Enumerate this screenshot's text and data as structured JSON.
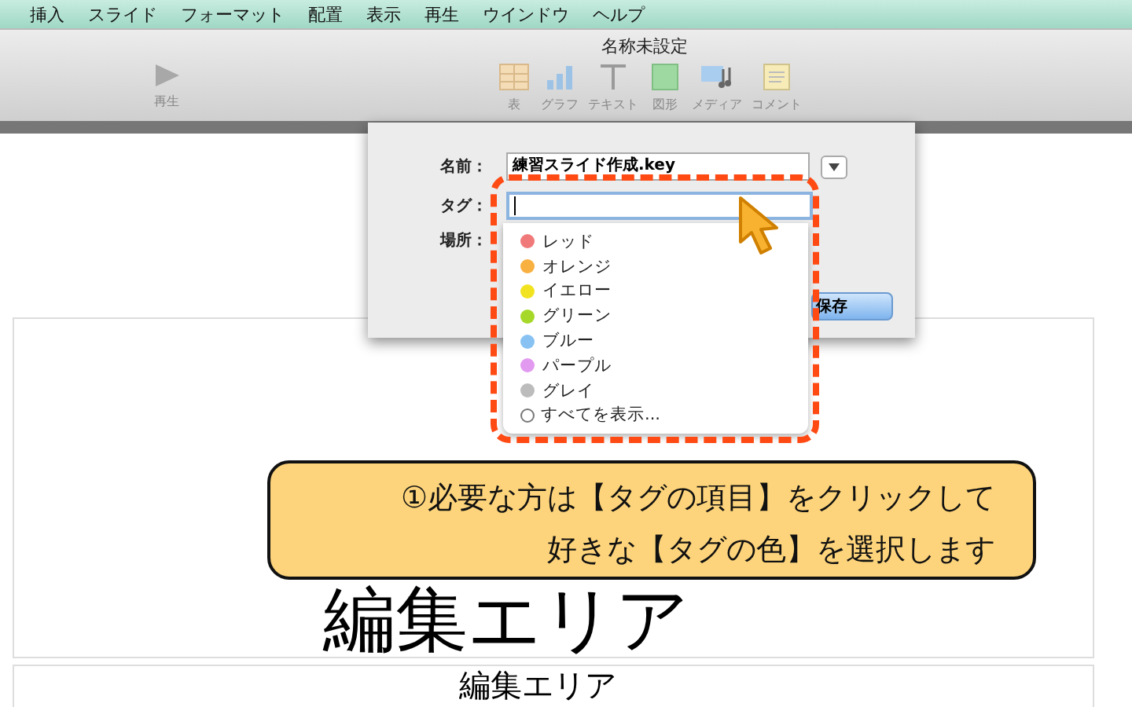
{
  "menu_bar": {
    "items": [
      "挿入",
      "スライド",
      "フォーマット",
      "配置",
      "表示",
      "再生",
      "ウインドウ",
      "ヘルプ"
    ]
  },
  "window": {
    "title": "名称未設定"
  },
  "toolbar": {
    "play": {
      "label": "再生"
    },
    "tools": [
      {
        "kind": "table",
        "label": "表"
      },
      {
        "kind": "chart",
        "label": "グラフ"
      },
      {
        "kind": "text",
        "label": "テキスト"
      },
      {
        "kind": "shape",
        "label": "図形"
      },
      {
        "kind": "media",
        "label": "メディア"
      },
      {
        "kind": "comment",
        "label": "コメント"
      }
    ]
  },
  "save_dialog": {
    "name_label": "名前：",
    "name_value": "練習スライド作成.key",
    "tag_label": "タグ：",
    "location_label": "場所：",
    "save_button": "保存",
    "tag_menu": [
      {
        "kind": "tag",
        "label": "レッド",
        "color": "#f07a7a"
      },
      {
        "kind": "tag",
        "label": "オレンジ",
        "color": "#f8b040"
      },
      {
        "kind": "tag",
        "label": "イエロー",
        "color": "#f2e320"
      },
      {
        "kind": "tag",
        "label": "グリーン",
        "color": "#a6d82a"
      },
      {
        "kind": "tag",
        "label": "ブルー",
        "color": "#88c2f2"
      },
      {
        "kind": "tag",
        "label": "パープル",
        "color": "#e29af0"
      },
      {
        "kind": "tag",
        "label": "グレイ",
        "color": "#bcbcbc"
      },
      {
        "kind": "show_all",
        "label": "すべてを表示..."
      }
    ]
  },
  "slides": [
    {
      "text": "編集エリア"
    },
    {
      "text": "編集エリア"
    }
  ],
  "callout": {
    "lines": [
      "①必要な方は【タグの項目】をクリックして",
      "好きな【タグの色】を選択します"
    ]
  }
}
